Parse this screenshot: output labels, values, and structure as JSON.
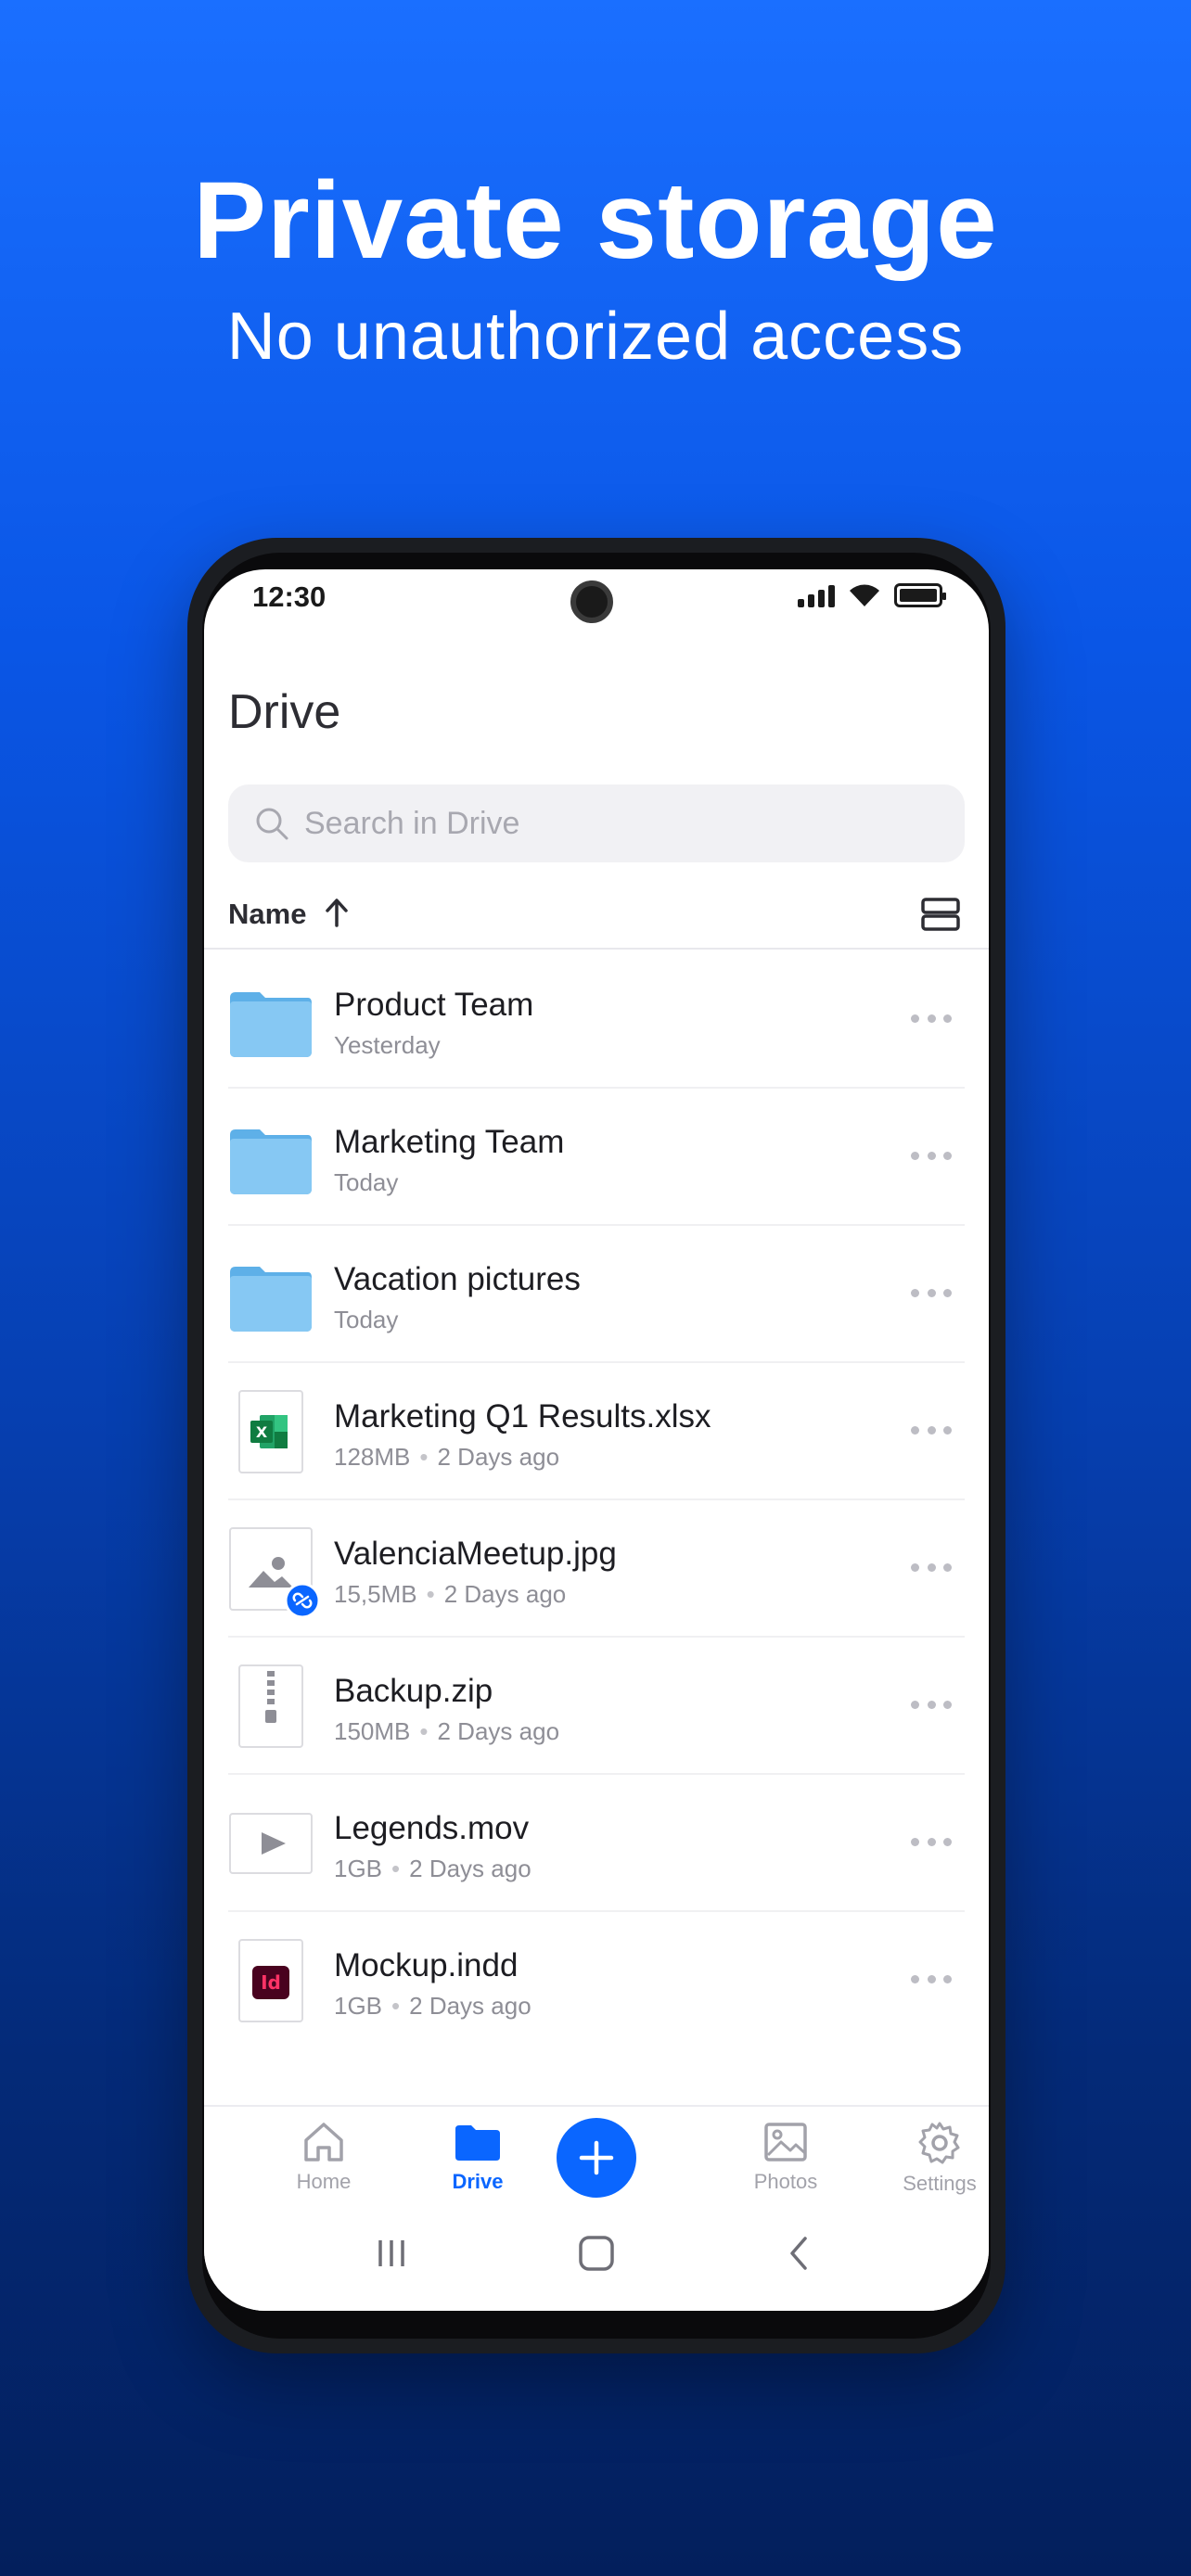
{
  "marketing": {
    "headline": "Private storage",
    "subheadline": "No unauthorized access"
  },
  "status_bar": {
    "time": "12:30"
  },
  "drive": {
    "title": "Drive",
    "search_placeholder": "Search in Drive",
    "sort_label": "Name"
  },
  "files": [
    {
      "name": "Product Team",
      "meta": "Yesterday",
      "size": "",
      "icon": "folder-icon"
    },
    {
      "name": "Marketing Team",
      "meta": "Today",
      "size": "",
      "icon": "folder-icon"
    },
    {
      "name": "Vacation pictures",
      "meta": "Today",
      "size": "",
      "icon": "folder-icon"
    },
    {
      "name": "Marketing Q1 Results.xlsx",
      "meta": "2 Days ago",
      "size": "128MB",
      "icon": "excel-file-icon"
    },
    {
      "name": "ValenciaMeetup.jpg",
      "meta": "2 Days ago",
      "size": "15,5MB",
      "icon": "image-file-icon"
    },
    {
      "name": "Backup.zip",
      "meta": "2 Days ago",
      "size": "150MB",
      "icon": "zip-file-icon"
    },
    {
      "name": "Legends.mov",
      "meta": "2 Days ago",
      "size": "1GB",
      "icon": "video-file-icon"
    },
    {
      "name": "Mockup.indd",
      "meta": "2 Days ago",
      "size": "1GB",
      "icon": "indesign-file-icon"
    }
  ],
  "tabs": {
    "home": "Home",
    "drive": "Drive",
    "photos": "Photos",
    "settings": "Settings"
  },
  "colors": {
    "accent": "#0a66ff",
    "folder": "#7cc4f2",
    "background_top": "#1a6fff",
    "background_bottom": "#031f5c"
  }
}
